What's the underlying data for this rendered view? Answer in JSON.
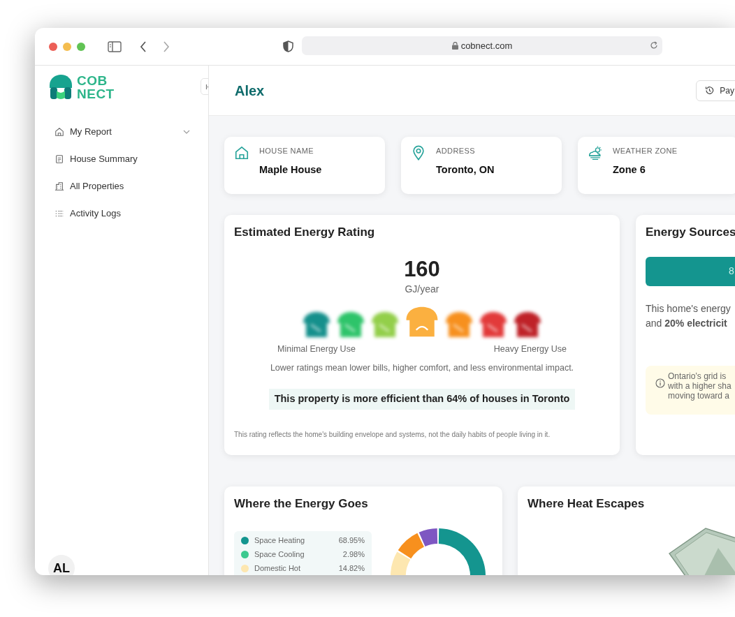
{
  "browser": {
    "url": "cobnect.com"
  },
  "sidebar": {
    "logo_lines": [
      "COB",
      "NECT"
    ],
    "items": [
      {
        "kind": "house",
        "label": "My Report",
        "has_submenu": true
      },
      {
        "kind": "document",
        "label": "House Summary",
        "has_submenu": false
      },
      {
        "kind": "building",
        "label": "All Properties",
        "has_submenu": false
      },
      {
        "kind": "list",
        "label": "Activity Logs",
        "has_submenu": false
      }
    ],
    "avatar": "AL"
  },
  "header": {
    "title": "Alex",
    "button": "Pay"
  },
  "info_cards": [
    {
      "kind": "house",
      "label": "HOUSE NAME",
      "value": "Maple House"
    },
    {
      "kind": "pin",
      "label": "ADDRESS",
      "value": "Toronto, ON"
    },
    {
      "kind": "weather",
      "label": "WEATHER ZONE",
      "value": "Zone 6"
    }
  ],
  "rating": {
    "title": "Estimated Energy Rating",
    "value": "160",
    "unit": "GJ/year",
    "scale": [
      {
        "color": "#15908c",
        "selected": false
      },
      {
        "color": "#2ec46a",
        "selected": false
      },
      {
        "color": "#93cf4a",
        "selected": false
      },
      {
        "color": "#fbb040",
        "selected": true
      },
      {
        "color": "#f7901e",
        "selected": false
      },
      {
        "color": "#e23a3a",
        "selected": false
      },
      {
        "color": "#bf2228",
        "selected": false
      }
    ],
    "low_label": "Minimal Energy Use",
    "high_label": "Heavy Energy Use",
    "note": "Lower ratings mean lower bills, higher comfort, and less environmental impact.",
    "comparison": "This property is more efficient than 64% of houses in Toronto",
    "footnote": "This rating reflects the home's building envelope and systems, not the daily habits of people living in it."
  },
  "energy_sources": {
    "title": "Energy Sources",
    "bar_label": "8",
    "lines": [
      "This home's energy",
      "and **20% electricit**"
    ],
    "info_lines": [
      "Ontario’s grid is",
      "with a higher sha",
      "moving toward a"
    ]
  },
  "energy_goes": {
    "title": "Where the Energy Goes",
    "legend": [
      {
        "label": "Space Heating",
        "value": "68.95%",
        "color": "#14958f"
      },
      {
        "label": "Space Cooling",
        "value": "2.98%",
        "color": "#3cc98f"
      },
      {
        "label": "Domestic Hot",
        "value": "14.82%",
        "color": "#fde7b0"
      }
    ]
  },
  "heat": {
    "title": "Where Heat Escapes"
  }
}
